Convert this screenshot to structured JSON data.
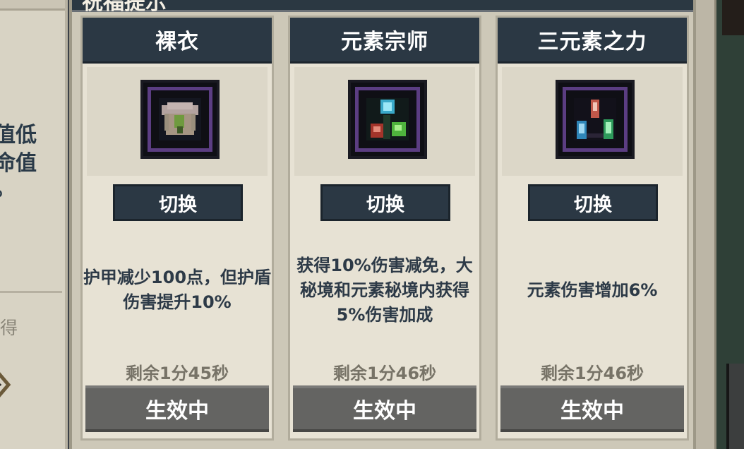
{
  "left_panel": {
    "line1": "值低",
    "line2": "命值",
    "line3": "。",
    "lower_text": "得"
  },
  "modal": {
    "title_fragment": "祝福提示"
  },
  "cards": [
    {
      "title": "裸衣",
      "icon": "shirt-icon",
      "switch_label": "切换",
      "description": "护甲减少100点，但护盾伤害提升10%",
      "remaining": "剩余1分45秒",
      "status_label": "生效中"
    },
    {
      "title": "元素宗师",
      "icon": "element-orbs-icon",
      "switch_label": "切换",
      "description": "获得10%伤害减免，大秘境和元素秘境内获得5%伤害加成",
      "remaining": "剩余1分46秒",
      "status_label": "生效中"
    },
    {
      "title": "三元素之力",
      "icon": "element-crystals-icon",
      "switch_label": "切换",
      "description": "元素伤害增加6%",
      "remaining": "剩余1分46秒",
      "status_label": "生效中"
    }
  ],
  "colors": {
    "header_bg": "#2b3844",
    "card_bg": "#e7e2d4",
    "active_button": "#646462",
    "icon_border": "#5b3d82"
  }
}
